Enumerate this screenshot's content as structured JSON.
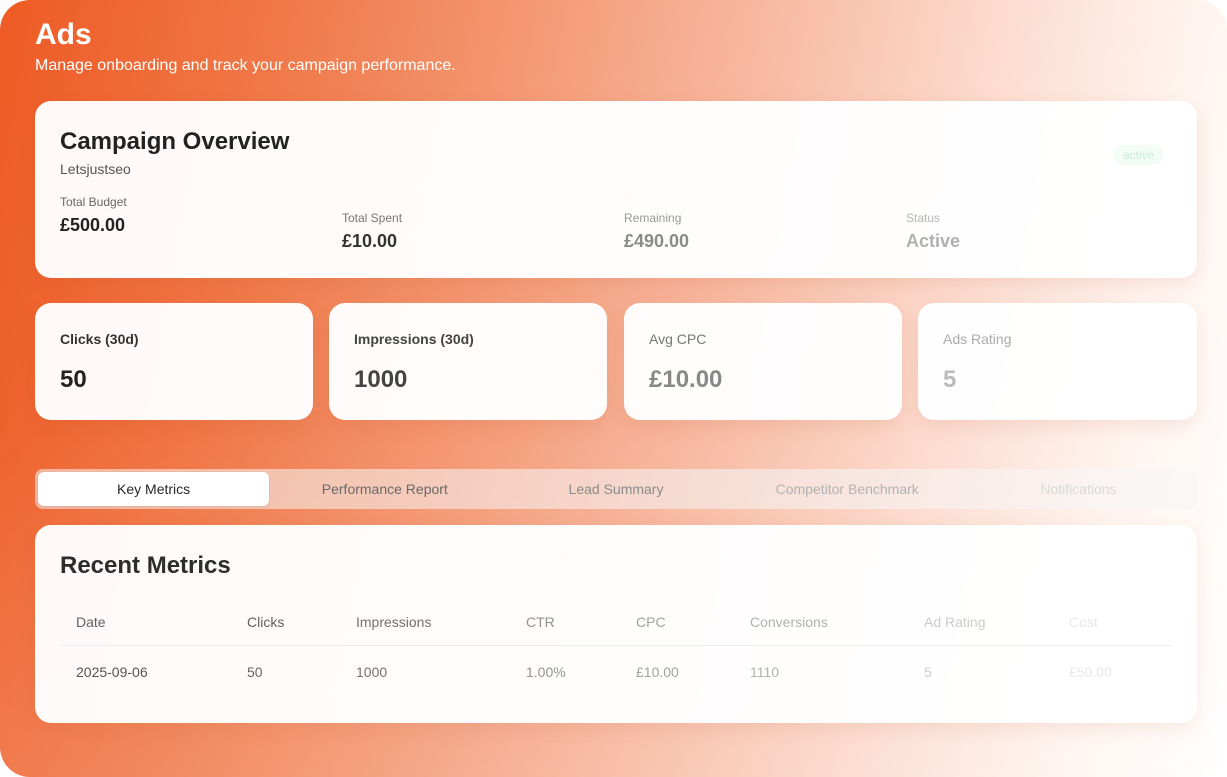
{
  "header": {
    "title": "Ads",
    "subtitle": "Manage onboarding and track your campaign performance."
  },
  "overview": {
    "title": "Campaign Overview",
    "account": "Letsjustseo",
    "badge": "active",
    "stats": [
      {
        "label": "Total Budget",
        "value": "£500.00"
      },
      {
        "label": "Total Spent",
        "value": "£10.00"
      },
      {
        "label": "Remaining",
        "value": "£490.00"
      },
      {
        "label": "Status",
        "value": "Active"
      }
    ]
  },
  "kpis": [
    {
      "label": "Clicks (30d)",
      "value": "50"
    },
    {
      "label": "Impressions (30d)",
      "value": "1000"
    },
    {
      "label": "Avg CPC",
      "value": "£10.00"
    },
    {
      "label": "Ads Rating",
      "value": "5"
    }
  ],
  "tabs": [
    {
      "label": "Key Metrics",
      "active": true
    },
    {
      "label": "Performance Report",
      "active": false
    },
    {
      "label": "Lead Summary",
      "active": false
    },
    {
      "label": "Competitor Benchmark",
      "active": false
    },
    {
      "label": "Notifications",
      "active": false
    }
  ],
  "recent": {
    "title": "Recent Metrics",
    "columns": [
      "Date",
      "Clicks",
      "Impressions",
      "CTR",
      "CPC",
      "Conversions",
      "Ad Rating",
      "Cost"
    ],
    "rows": [
      [
        "2025-09-06",
        "50",
        "1000",
        "1.00%",
        "£10.00",
        "1110",
        "5",
        "£50.00"
      ]
    ]
  },
  "colors": {
    "accent": "#ee5a24",
    "badge_text": "#c9ecd5"
  }
}
